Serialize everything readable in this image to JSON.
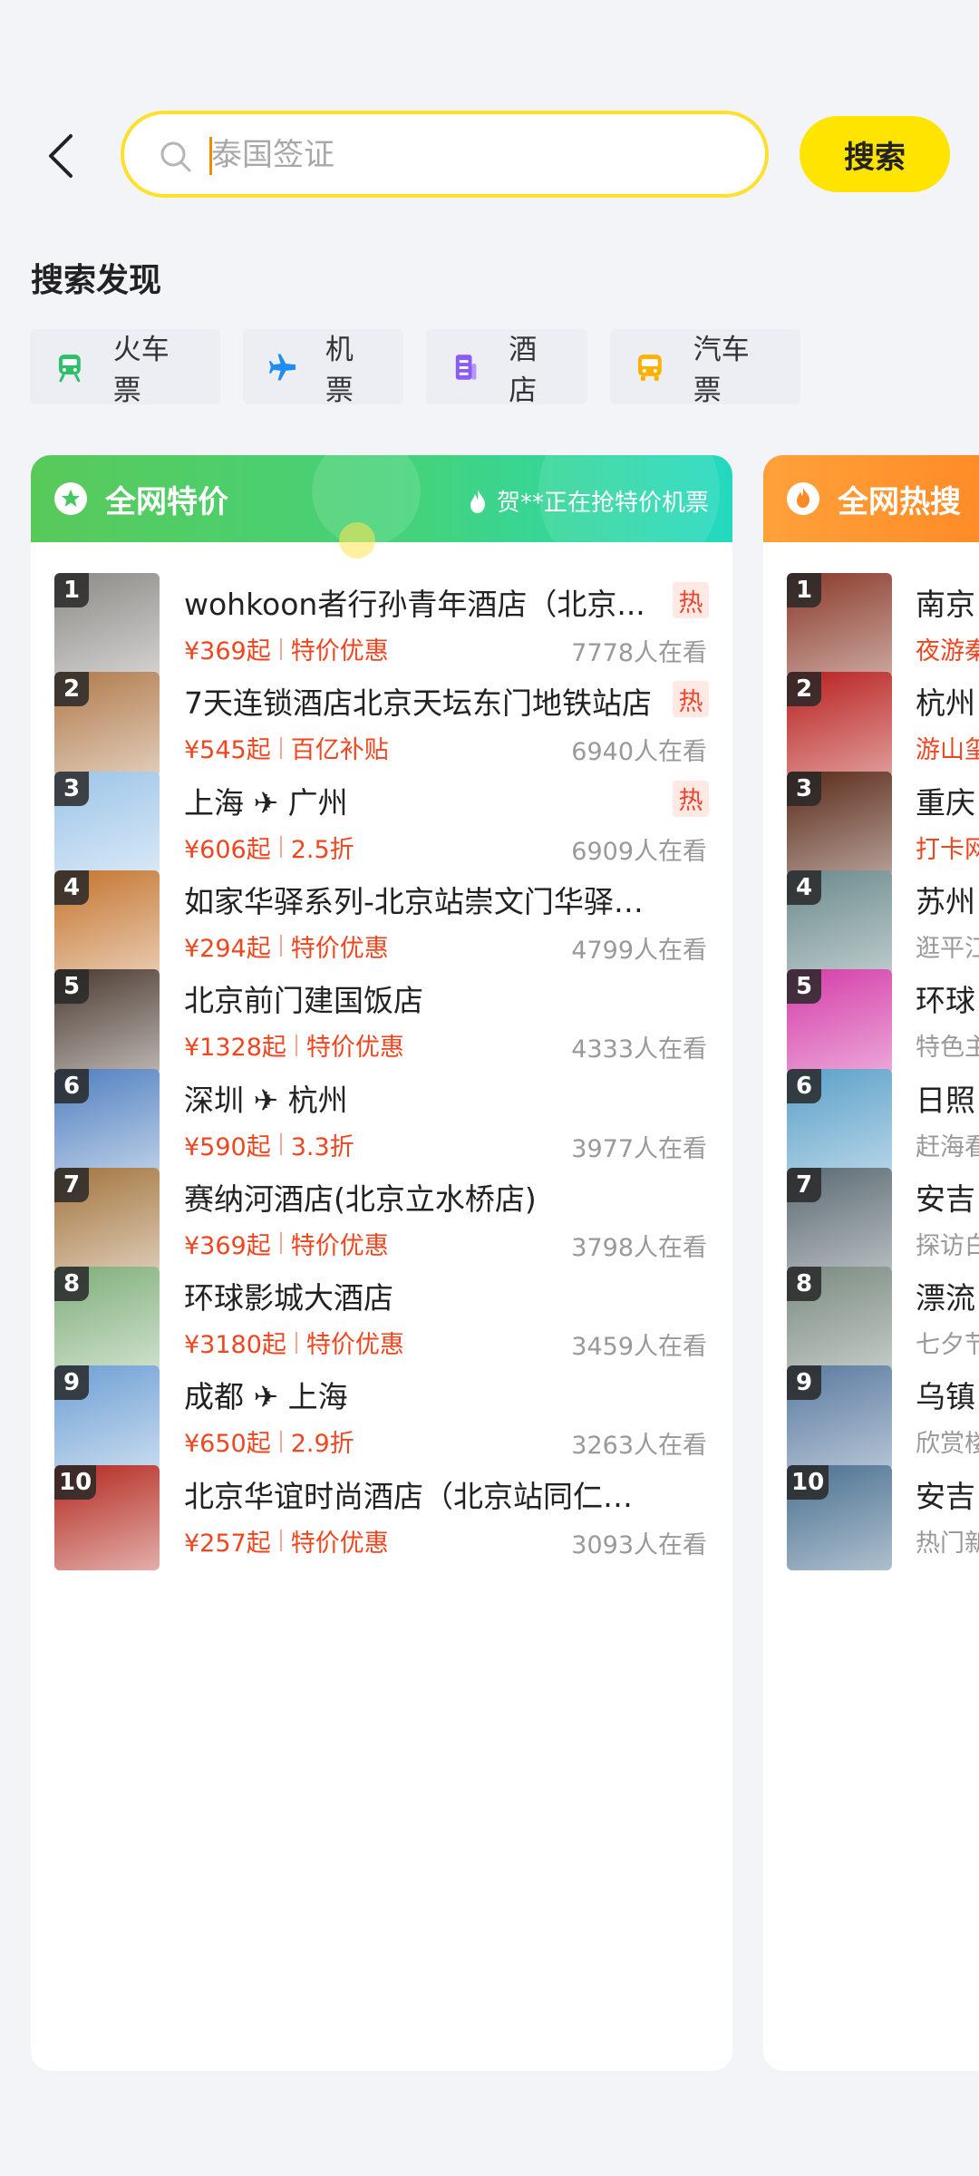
{
  "search": {
    "placeholder": "泰国签证",
    "button_label": "搜索"
  },
  "discover": {
    "title": "搜索发现",
    "chips": [
      {
        "label": "火车票",
        "icon": "train-icon",
        "color": "#2dbf6a"
      },
      {
        "label": "机票",
        "icon": "plane-icon",
        "color": "#1e8cf0"
      },
      {
        "label": "酒店",
        "icon": "hotel-icon",
        "color": "#8a5cf5"
      },
      {
        "label": "汽车票",
        "icon": "bus-icon",
        "color": "#ffb000"
      }
    ]
  },
  "deals": {
    "title": "全网特价",
    "notice": "贺**正在抢特价机票",
    "items": [
      {
        "rank": "1",
        "title": "wohkoon者行孙青年酒店（北京...",
        "price": "¥369起",
        "tag": "特价优惠",
        "viewers": "7778人在看",
        "hot": "热",
        "thumb": "#8c8a86"
      },
      {
        "rank": "2",
        "title": "7天连锁酒店北京天坛东门地铁站店",
        "price": "¥545起",
        "tag": "百亿补贴",
        "viewers": "6940人在看",
        "hot": "热",
        "thumb": "#b07a4a"
      },
      {
        "rank": "3",
        "title": "上海 ✈ 广州",
        "price": "¥606起",
        "tag": "2.5折",
        "viewers": "6909人在看",
        "hot": "热",
        "thumb": "#9cc4e8"
      },
      {
        "rank": "4",
        "title": "如家华驿系列-北京站崇文门华驿酒店",
        "price": "¥294起",
        "tag": "特价优惠",
        "viewers": "4799人在看",
        "hot": "",
        "thumb": "#c4742e"
      },
      {
        "rank": "5",
        "title": "北京前门建国饭店",
        "price": "¥1328起",
        "tag": "特价优惠",
        "viewers": "4333人在看",
        "hot": "",
        "thumb": "#4a3a30"
      },
      {
        "rank": "6",
        "title": "深圳 ✈ 杭州",
        "price": "¥590起",
        "tag": "3.3折",
        "viewers": "3977人在看",
        "hot": "",
        "thumb": "#4f7fbf"
      },
      {
        "rank": "7",
        "title": "赛纳河酒店(北京立水桥店)",
        "price": "¥369起",
        "tag": "特价优惠",
        "viewers": "3798人在看",
        "hot": "",
        "thumb": "#a2743c"
      },
      {
        "rank": "8",
        "title": "环球影城大酒店",
        "price": "¥3180起",
        "tag": "特价优惠",
        "viewers": "3459人在看",
        "hot": "",
        "thumb": "#7fae7a"
      },
      {
        "rank": "9",
        "title": "成都 ✈ 上海",
        "price": "¥650起",
        "tag": "2.9折",
        "viewers": "3263人在看",
        "hot": "",
        "thumb": "#6d9fd4"
      },
      {
        "rank": "10",
        "title": "北京华谊时尚酒店（北京站同仁医院店）",
        "price": "¥257起",
        "tag": "特价优惠",
        "viewers": "3093人在看",
        "hot": "",
        "thumb": "#b3281e"
      }
    ]
  },
  "trending": {
    "title": "全网热搜",
    "items": [
      {
        "rank": "1",
        "title": "南京",
        "sub": "夜游秦",
        "sub_color": "#f0461f",
        "thumb": "#8a3a2a"
      },
      {
        "rank": "2",
        "title": "杭州",
        "sub": "游山玺",
        "sub_color": "#f0461f",
        "thumb": "#b8201e"
      },
      {
        "rank": "3",
        "title": "重庆",
        "sub": "打卡网",
        "sub_color": "#f0461f",
        "thumb": "#5a2a18"
      },
      {
        "rank": "4",
        "title": "苏州",
        "sub": "逛平江",
        "sub_color": "#999999",
        "thumb": "#6b8a8c"
      },
      {
        "rank": "5",
        "title": "环球",
        "sub": "特色主",
        "sub_color": "#999999",
        "thumb": "#d43ca8"
      },
      {
        "rank": "6",
        "title": "日照",
        "sub": "赶海看",
        "sub_color": "#999999",
        "thumb": "#5aa0c8"
      },
      {
        "rank": "7",
        "title": "安吉",
        "sub": "探访白",
        "sub_color": "#999999",
        "thumb": "#5c6a72"
      },
      {
        "rank": "8",
        "title": "漂流",
        "sub": "七夕节",
        "sub_color": "#999999",
        "thumb": "#7a8a80"
      },
      {
        "rank": "9",
        "title": "乌镇",
        "sub": "欣赏楼",
        "sub_color": "#999999",
        "thumb": "#5a7aa0"
      },
      {
        "rank": "10",
        "title": "安吉",
        "sub": "热门新",
        "sub_color": "#999999",
        "thumb": "#4a7090"
      }
    ]
  }
}
